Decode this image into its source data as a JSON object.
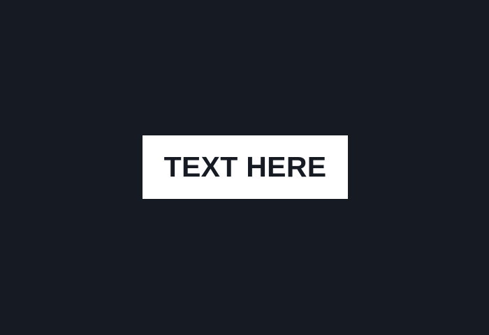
{
  "label": {
    "text": "TEXT HERE"
  },
  "colors": {
    "background": "#161a22",
    "box": "#ffffff",
    "text": "#161a22"
  }
}
